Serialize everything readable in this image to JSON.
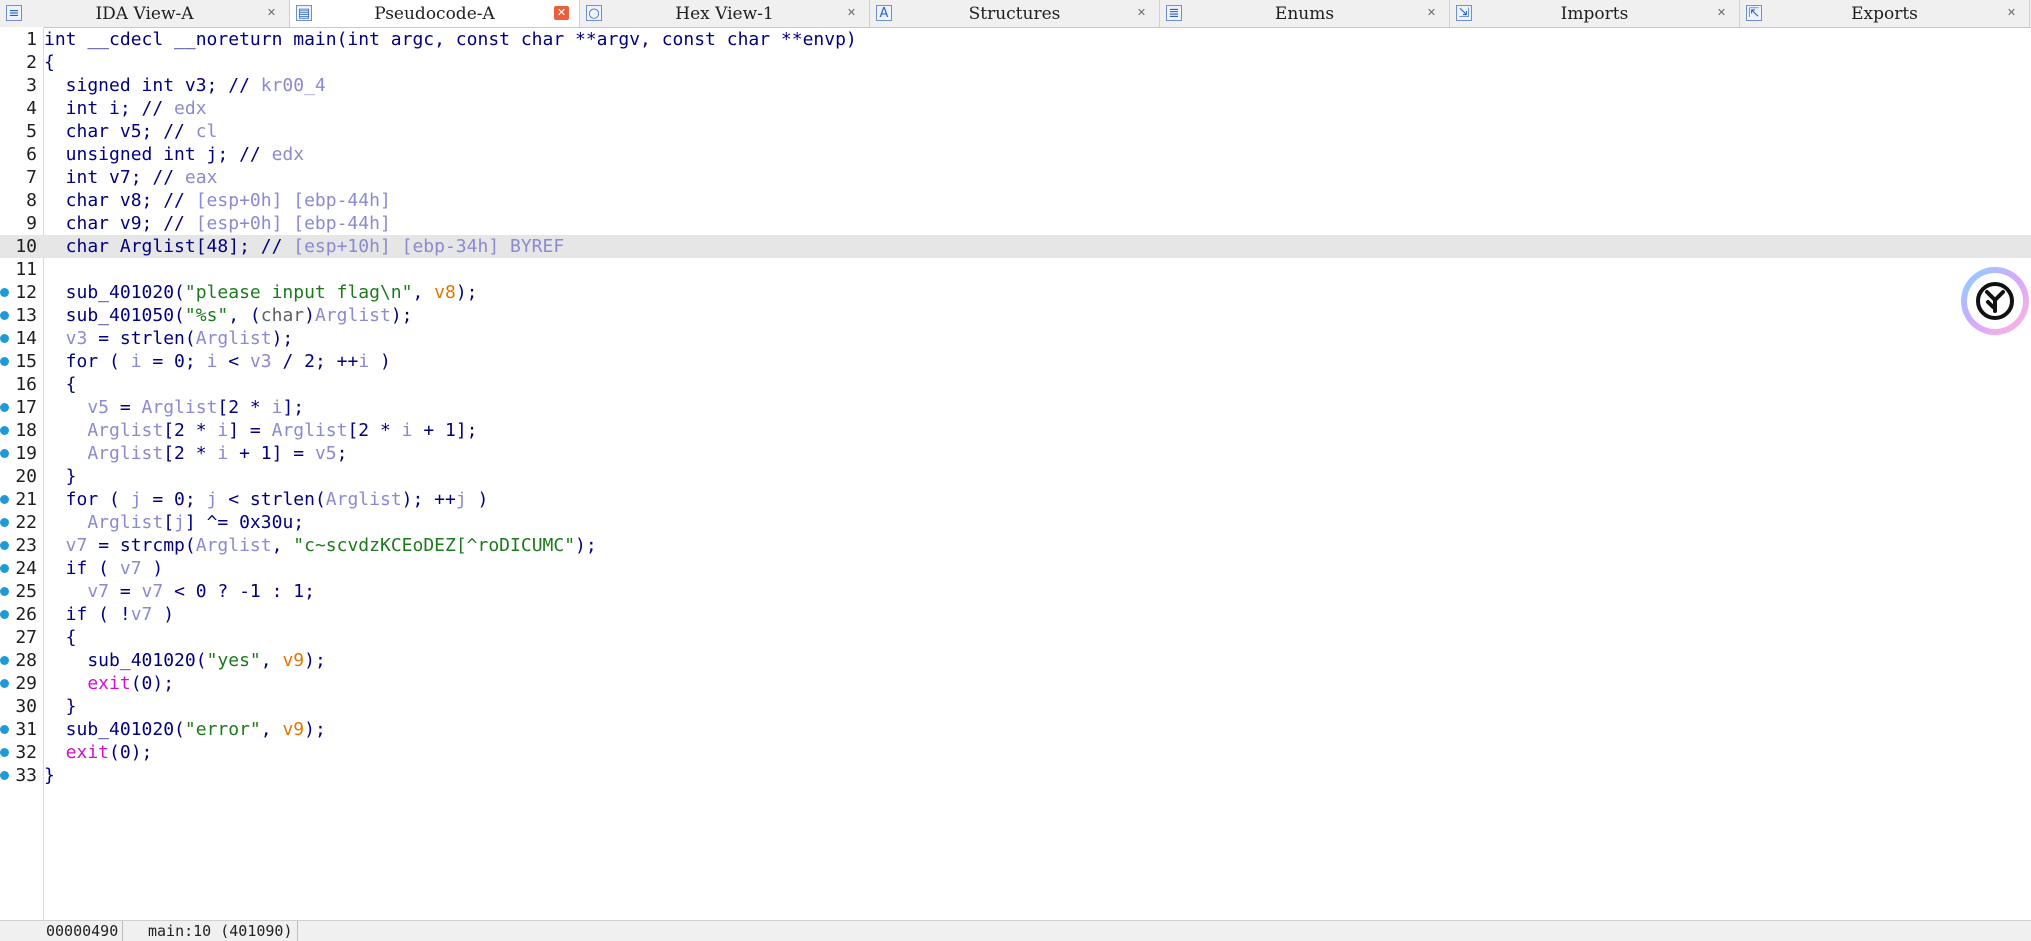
{
  "tabs": [
    {
      "label": "IDA View-A",
      "icon": "ida-view-icon",
      "active": false
    },
    {
      "label": "Pseudocode-A",
      "icon": "pseudocode-icon",
      "active": true
    },
    {
      "label": "Hex View-1",
      "icon": "hex-view-icon",
      "active": false
    },
    {
      "label": "Structures",
      "icon": "structures-icon",
      "active": false
    },
    {
      "label": "Enums",
      "icon": "enums-icon",
      "active": false
    },
    {
      "label": "Imports",
      "icon": "imports-icon",
      "active": false
    },
    {
      "label": "Exports",
      "icon": "exports-icon",
      "active": false
    }
  ],
  "code": {
    "highlighted_line": 10,
    "lines": [
      {
        "n": "1",
        "bp": false,
        "segs": [
          [
            "",
            "int __cdecl __noreturn main(int argc, const char **argv, const char **envp)"
          ]
        ]
      },
      {
        "n": "2",
        "bp": false,
        "segs": [
          [
            "",
            "{"
          ]
        ]
      },
      {
        "n": "3",
        "bp": false,
        "segs": [
          [
            "",
            "  signed int v3; // "
          ],
          [
            "v",
            "kr00_4"
          ]
        ]
      },
      {
        "n": "4",
        "bp": false,
        "segs": [
          [
            "",
            "  int i; // "
          ],
          [
            "v",
            "edx"
          ]
        ]
      },
      {
        "n": "5",
        "bp": false,
        "segs": [
          [
            "",
            "  char v5; // "
          ],
          [
            "v",
            "cl"
          ]
        ]
      },
      {
        "n": "6",
        "bp": false,
        "segs": [
          [
            "",
            "  unsigned int j; // "
          ],
          [
            "v",
            "edx"
          ]
        ]
      },
      {
        "n": "7",
        "bp": false,
        "segs": [
          [
            "",
            "  int v7; // "
          ],
          [
            "v",
            "eax"
          ]
        ]
      },
      {
        "n": "8",
        "bp": false,
        "segs": [
          [
            "",
            "  char v8; // "
          ],
          [
            "v",
            "[esp+0h] [ebp-44h]"
          ]
        ]
      },
      {
        "n": "9",
        "bp": false,
        "segs": [
          [
            "",
            "  char v9; // "
          ],
          [
            "v",
            "[esp+0h] [ebp-44h]"
          ]
        ]
      },
      {
        "n": "10",
        "bp": false,
        "segs": [
          [
            "",
            "  char Arglist[48]; // "
          ],
          [
            "v",
            "[esp+10h] [ebp-34h] BYREF"
          ]
        ]
      },
      {
        "n": "11",
        "bp": false,
        "segs": [
          [
            "",
            ""
          ]
        ]
      },
      {
        "n": "12",
        "bp": true,
        "segs": [
          [
            "",
            "  sub_401020("
          ],
          [
            "s",
            "\"please input flag\\n\""
          ],
          [
            "",
            ", "
          ],
          [
            "o",
            "v8"
          ],
          [
            "",
            ");"
          ]
        ]
      },
      {
        "n": "13",
        "bp": true,
        "segs": [
          [
            "",
            "  sub_401050("
          ],
          [
            "s",
            "\"%s\""
          ],
          [
            "",
            ", ("
          ],
          [
            "t",
            "char"
          ],
          [
            "",
            ")"
          ],
          [
            "v",
            "Arglist"
          ],
          [
            "",
            ");"
          ]
        ]
      },
      {
        "n": "14",
        "bp": true,
        "segs": [
          [
            "v",
            "  v3"
          ],
          [
            "",
            " = strlen("
          ],
          [
            "v",
            "Arglist"
          ],
          [
            "",
            ");"
          ]
        ]
      },
      {
        "n": "15",
        "bp": true,
        "segs": [
          [
            "",
            "  for ( "
          ],
          [
            "v",
            "i"
          ],
          [
            "",
            " = 0; "
          ],
          [
            "v",
            "i"
          ],
          [
            "",
            " < "
          ],
          [
            "v",
            "v3"
          ],
          [
            "",
            " / 2; ++"
          ],
          [
            "v",
            "i"
          ],
          [
            "",
            " )"
          ]
        ]
      },
      {
        "n": "16",
        "bp": false,
        "segs": [
          [
            "",
            "  {"
          ]
        ]
      },
      {
        "n": "17",
        "bp": true,
        "segs": [
          [
            "v",
            "    v5"
          ],
          [
            "",
            " = "
          ],
          [
            "v",
            "Arglist"
          ],
          [
            "",
            "[2 * "
          ],
          [
            "v",
            "i"
          ],
          [
            "",
            "];"
          ]
        ]
      },
      {
        "n": "18",
        "bp": true,
        "segs": [
          [
            "v",
            "    Arglist"
          ],
          [
            "",
            "[2 * "
          ],
          [
            "v",
            "i"
          ],
          [
            "",
            "] = "
          ],
          [
            "v",
            "Arglist"
          ],
          [
            "",
            "[2 * "
          ],
          [
            "v",
            "i"
          ],
          [
            "",
            " + 1];"
          ]
        ]
      },
      {
        "n": "19",
        "bp": true,
        "segs": [
          [
            "v",
            "    Arglist"
          ],
          [
            "",
            "[2 * "
          ],
          [
            "v",
            "i"
          ],
          [
            "",
            " + 1] = "
          ],
          [
            "v",
            "v5"
          ],
          [
            "",
            ";"
          ]
        ]
      },
      {
        "n": "20",
        "bp": false,
        "segs": [
          [
            "",
            "  }"
          ]
        ]
      },
      {
        "n": "21",
        "bp": true,
        "segs": [
          [
            "",
            "  for ( "
          ],
          [
            "v",
            "j"
          ],
          [
            "",
            " = 0; "
          ],
          [
            "v",
            "j"
          ],
          [
            "",
            " < strlen("
          ],
          [
            "v",
            "Arglist"
          ],
          [
            "",
            "); ++"
          ],
          [
            "v",
            "j"
          ],
          [
            "",
            " )"
          ]
        ]
      },
      {
        "n": "22",
        "bp": true,
        "segs": [
          [
            "v",
            "    Arglist"
          ],
          [
            "",
            "["
          ],
          [
            "v",
            "j"
          ],
          [
            "",
            "] ^= 0x30u;"
          ]
        ]
      },
      {
        "n": "23",
        "bp": true,
        "segs": [
          [
            "v",
            "  v7"
          ],
          [
            "",
            " = strcmp("
          ],
          [
            "v",
            "Arglist"
          ],
          [
            "",
            ", "
          ],
          [
            "s",
            "\"c~scvdzKCEoDEZ[^roDICUMC\""
          ],
          [
            "",
            ");"
          ]
        ]
      },
      {
        "n": "24",
        "bp": true,
        "segs": [
          [
            "",
            "  if ( "
          ],
          [
            "v",
            "v7"
          ],
          [
            "",
            " )"
          ]
        ]
      },
      {
        "n": "25",
        "bp": true,
        "segs": [
          [
            "v",
            "    v7"
          ],
          [
            "",
            " = "
          ],
          [
            "v",
            "v7"
          ],
          [
            "",
            " < 0 ? -1 : 1;"
          ]
        ]
      },
      {
        "n": "26",
        "bp": true,
        "segs": [
          [
            "",
            "  if ( !"
          ],
          [
            "v",
            "v7"
          ],
          [
            "",
            " )"
          ]
        ]
      },
      {
        "n": "27",
        "bp": false,
        "segs": [
          [
            "",
            "  {"
          ]
        ]
      },
      {
        "n": "28",
        "bp": true,
        "segs": [
          [
            "",
            "    sub_401020("
          ],
          [
            "s",
            "\"yes\""
          ],
          [
            "",
            ", "
          ],
          [
            "o",
            "v9"
          ],
          [
            "",
            ");"
          ]
        ]
      },
      {
        "n": "29",
        "bp": true,
        "segs": [
          [
            "f",
            "    exit"
          ],
          [
            "",
            "(0);"
          ]
        ]
      },
      {
        "n": "30",
        "bp": false,
        "segs": [
          [
            "",
            "  }"
          ]
        ]
      },
      {
        "n": "31",
        "bp": true,
        "segs": [
          [
            "",
            "  sub_401020("
          ],
          [
            "s",
            "\"error\""
          ],
          [
            "",
            ", "
          ],
          [
            "o",
            "v9"
          ],
          [
            "",
            ");"
          ]
        ]
      },
      {
        "n": "32",
        "bp": true,
        "segs": [
          [
            "f",
            "  exit"
          ],
          [
            "",
            "(0);"
          ]
        ]
      },
      {
        "n": "33",
        "bp": true,
        "segs": [
          [
            "",
            "}"
          ]
        ]
      }
    ]
  },
  "status": {
    "offset": "00000490",
    "location": "main:10 (401090)"
  },
  "assistant": {
    "icon": "assistant-logo-icon"
  }
}
